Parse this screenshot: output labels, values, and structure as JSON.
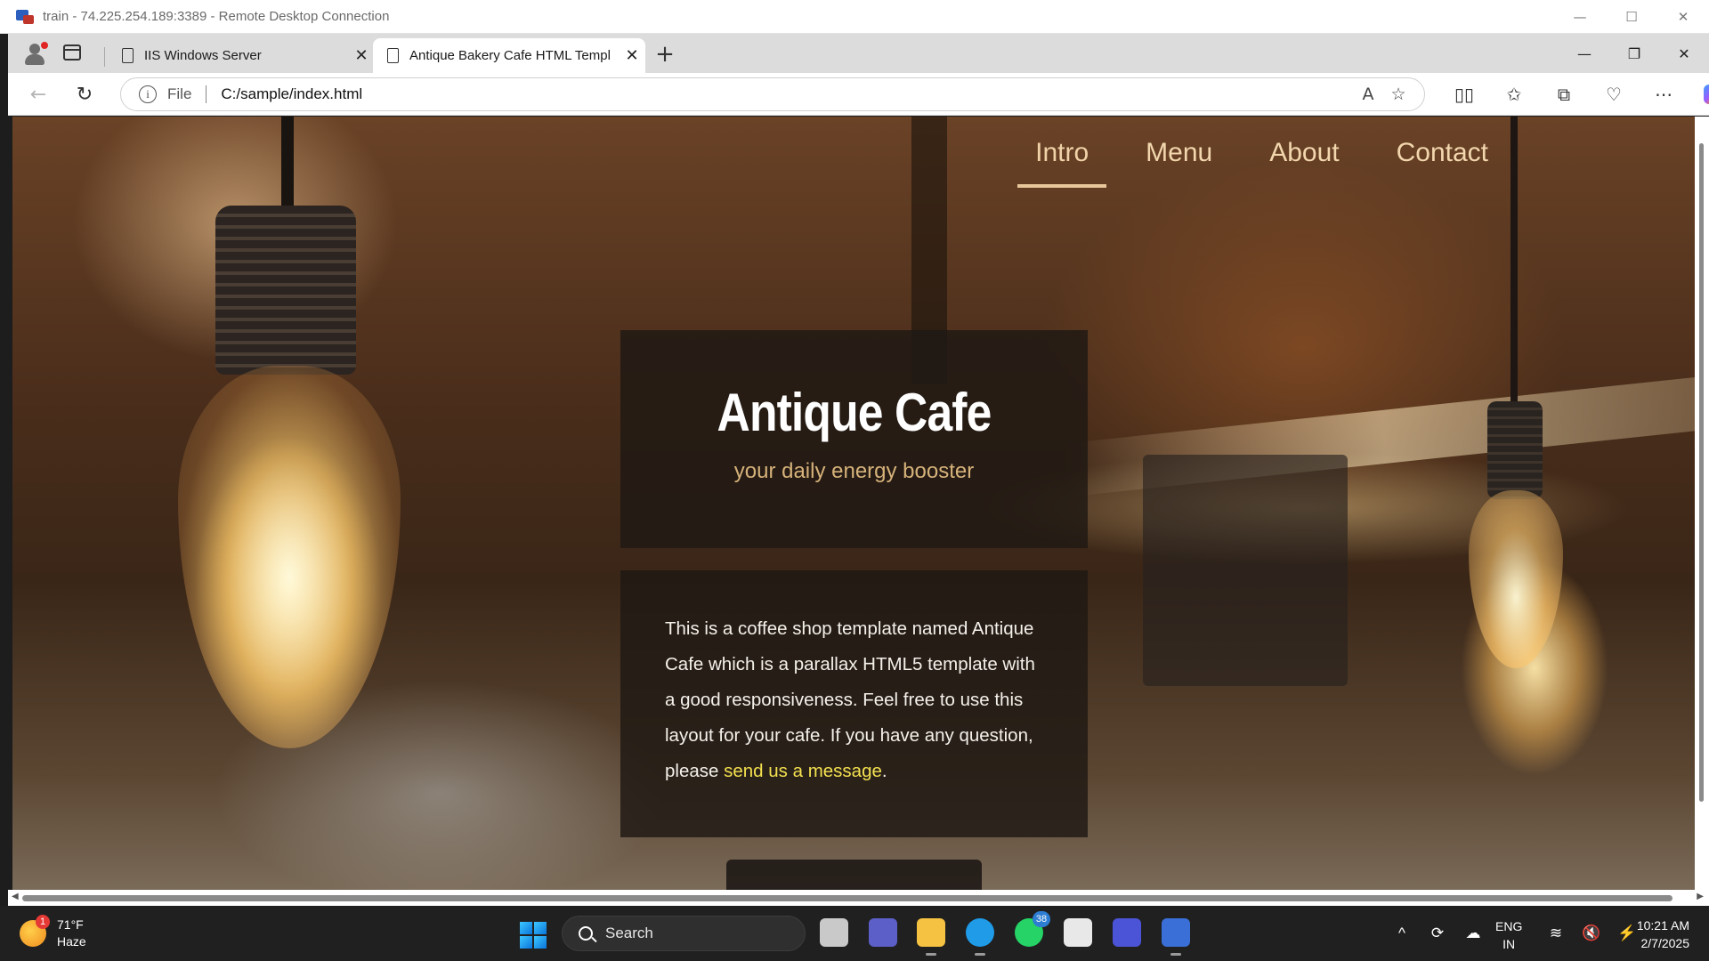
{
  "rdp": {
    "title": "train - 74.225.254.189:3389 - Remote Desktop Connection",
    "minimize": "—",
    "maximize": "☐",
    "close": "✕"
  },
  "browser": {
    "tabs": [
      {
        "label": "IIS Windows Server",
        "close": "✕",
        "active": false
      },
      {
        "label": "Antique Bakery Cafe HTML Templ",
        "close": "✕",
        "active": true
      }
    ],
    "new_tab": "+",
    "window_controls": {
      "minimize": "—",
      "restore": "❐",
      "close": "✕"
    },
    "nav": {
      "back": "←",
      "reload": "↻"
    },
    "address": {
      "info": "i",
      "scheme_label": "File",
      "url": "C:/sample/index.html",
      "read_aloud": "A",
      "favorite": "☆"
    },
    "toolbar_icons": [
      "▯▯",
      "✩",
      "⧉",
      "♡",
      "⋯"
    ]
  },
  "site": {
    "nav": [
      {
        "label": "Intro",
        "active": true
      },
      {
        "label": "Menu",
        "active": false
      },
      {
        "label": "About",
        "active": false
      },
      {
        "label": "Contact",
        "active": false
      }
    ],
    "hero_title": "Antique Cafe",
    "hero_tagline": "your daily energy booster",
    "about_text": "This is a coffee shop template named Antique Cafe which is a parallax HTML5 template with a good responsiveness. Feel free to use this layout for your cafe. If you have any question, please ",
    "about_link": "send us a message",
    "about_end": "."
  },
  "taskbar": {
    "weather": {
      "badge": "1",
      "temp": "71°F",
      "condition": "Haze"
    },
    "search_label": "Search",
    "apps": [
      {
        "name": "task-view",
        "color": "#c9c9c9",
        "running": false
      },
      {
        "name": "teams-meet",
        "color": "#5b5fc7",
        "running": false
      },
      {
        "name": "file-explorer",
        "color": "#f5c242",
        "running": true
      },
      {
        "name": "edge",
        "color": "#1f9be8",
        "running": true
      },
      {
        "name": "whatsapp",
        "color": "#25d366",
        "running": false,
        "badge": "38"
      },
      {
        "name": "microsoft-store",
        "color": "#e8e8e8",
        "running": false
      },
      {
        "name": "visual-studio",
        "color": "#4b53d6",
        "running": false
      },
      {
        "name": "remote-desktop",
        "color": "#3a6fd8",
        "running": true
      }
    ],
    "tray_icons": [
      "^",
      "⟳",
      "☁"
    ],
    "lang": {
      "line1": "ENG",
      "line2": "IN"
    },
    "tray_icons2": [
      "≋",
      "🔇",
      "⚡"
    ],
    "time": "10:21 AM",
    "date": "2/7/2025"
  }
}
